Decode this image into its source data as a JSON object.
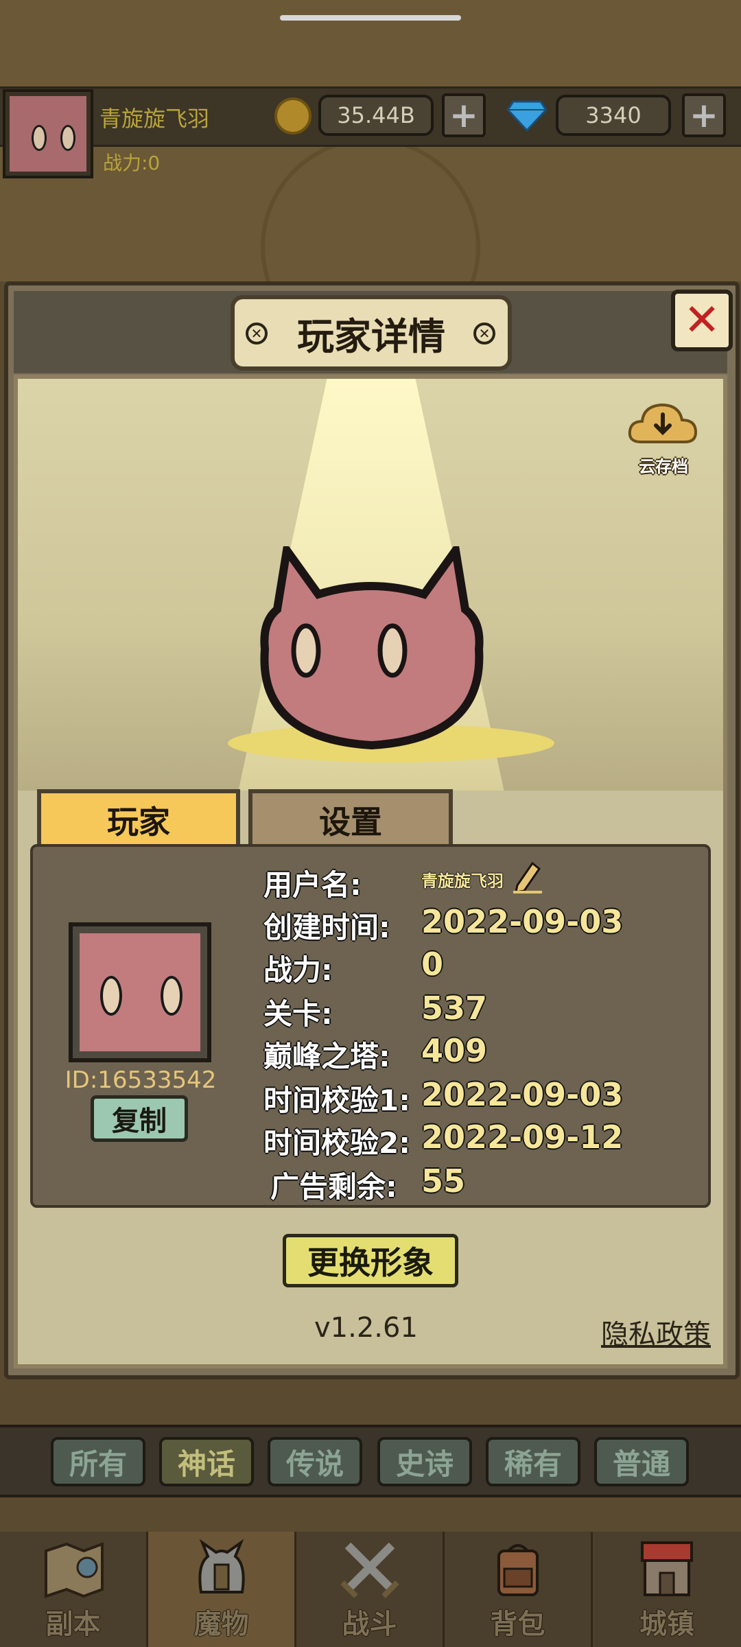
{
  "top_bar": {
    "player_name": "青旋旋飞羽",
    "power_label": "战力:0",
    "gold_amount": "35.44B",
    "gem_amount": "3340",
    "plus_symbol": "+"
  },
  "dialog": {
    "title": "玩家详情",
    "close_symbol": "✕",
    "cloud_save_label": "云存档",
    "tabs": [
      {
        "label": "玩家",
        "active": true
      },
      {
        "label": "设置",
        "active": false
      }
    ],
    "player_id": "ID:16533542",
    "copy_label": "复制",
    "fields": [
      {
        "label": "用户名:",
        "value": "青旋旋飞羽"
      },
      {
        "label": "创建时间:",
        "value": "2022-09-03"
      },
      {
        "label": "战力:",
        "value": "0"
      },
      {
        "label": "关卡:",
        "value": "537"
      },
      {
        "label": "巅峰之塔:",
        "value": "409"
      },
      {
        "label": "时间校验1:",
        "value": "2022-09-03"
      },
      {
        "label": "时间校验2:",
        "value": "2022-09-12"
      },
      {
        "label": "广告剩余:",
        "value": "55"
      }
    ],
    "change_avatar_label": "更换形象",
    "version": "v1.2.61",
    "privacy_label": "隐私政策"
  },
  "filters": [
    {
      "label": "所有",
      "active": false
    },
    {
      "label": "神话",
      "active": true
    },
    {
      "label": "传说",
      "active": false
    },
    {
      "label": "史诗",
      "active": false
    },
    {
      "label": "稀有",
      "active": false
    },
    {
      "label": "普通",
      "active": false
    }
  ],
  "nav": [
    {
      "label": "副本",
      "icon": "map-icon",
      "active": false
    },
    {
      "label": "魔物",
      "icon": "monster-helmet-icon",
      "active": true
    },
    {
      "label": "战斗",
      "icon": "crossed-swords-icon",
      "active": false
    },
    {
      "label": "背包",
      "icon": "backpack-icon",
      "active": false
    },
    {
      "label": "城镇",
      "icon": "town-shop-icon",
      "active": false
    }
  ],
  "colors": {
    "accent_tab": "#f6c85a",
    "value_text": "#f6e69a",
    "close_x": "#c02222",
    "monster_pink": "#c27c7e"
  }
}
